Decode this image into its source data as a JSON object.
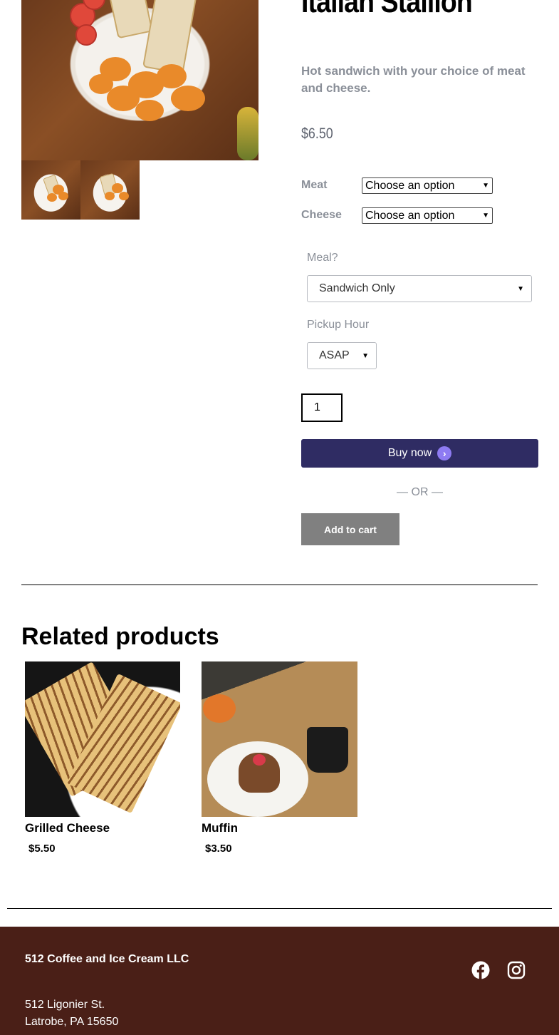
{
  "product": {
    "title": "Italian Stallion",
    "description": "Hot sandwich with your choice of meat and cheese.",
    "price": "$6.50"
  },
  "attributes": [
    {
      "label": "Meat",
      "value": "Choose an option"
    },
    {
      "label": "Cheese",
      "value": "Choose an option"
    }
  ],
  "addons": {
    "meal": {
      "label": "Meal?",
      "value": "Sandwich Only"
    },
    "pickup": {
      "label": "Pickup Hour",
      "value": "ASAP"
    }
  },
  "quantity": "1",
  "buy_now": {
    "label": "Buy now"
  },
  "or_text": "— OR —",
  "add_to_cart": "Add to cart",
  "related": {
    "heading": "Related products",
    "items": [
      {
        "name": "Grilled Cheese",
        "price": "$5.50"
      },
      {
        "name": "Muffin",
        "price": "$3.50"
      }
    ]
  },
  "footer": {
    "company": "512 Coffee and Ice Cream LLC",
    "address_line1": "512 Ligonier St.",
    "address_line2": "Latrobe, PA 15650",
    "social": [
      "facebook-icon",
      "instagram-icon"
    ]
  },
  "colors": {
    "buy_button": "#2f2c63",
    "cart_button": "#808080",
    "footer_bg": "#4a1f17"
  }
}
